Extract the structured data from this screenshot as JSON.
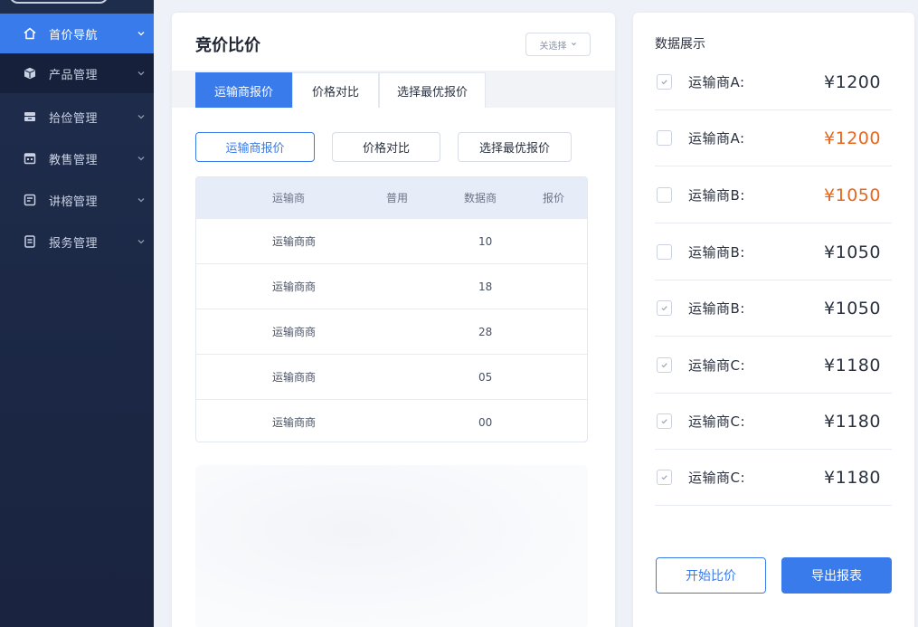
{
  "colors": {
    "accent": "#3a7bec",
    "sidebar_bg": "#1f2d4d",
    "price_highlight": "#e8661e"
  },
  "sidebar": {
    "items": [
      {
        "label": "首价导航",
        "icon": "home-icon",
        "active": true
      },
      {
        "label": "产品管理",
        "icon": "box-icon"
      },
      {
        "label": "拾俭管理",
        "icon": "folder-icon"
      },
      {
        "label": "教售管理",
        "icon": "calendar-icon"
      },
      {
        "label": "讲榕管理",
        "icon": "message-icon"
      },
      {
        "label": "报务管理",
        "icon": "document-icon"
      }
    ]
  },
  "main": {
    "title": "竞价比价",
    "filter": {
      "label": "关选择",
      "icon": "chevron-down-icon"
    },
    "tabs": [
      {
        "label": "运输商报价",
        "active": true
      },
      {
        "label": "价格对比"
      },
      {
        "label": "选择最优报价"
      }
    ],
    "buttons": [
      {
        "label": "运输商报价",
        "active": true
      },
      {
        "label": "价格对比"
      },
      {
        "label": "选择最优报价"
      }
    ],
    "table": {
      "headers": [
        "运输商",
        "普用",
        "数据商",
        "报价"
      ],
      "rows": [
        {
          "name": "运输商商",
          "value": "10"
        },
        {
          "name": "运输商商",
          "value": "18"
        },
        {
          "name": "运输商商",
          "value": "28"
        },
        {
          "name": "运输商商",
          "value": "05"
        },
        {
          "name": "运输商商",
          "value": "00"
        }
      ]
    }
  },
  "panel": {
    "title": "数据展示",
    "rows": [
      {
        "label": "运输商A:",
        "price": "¥1200",
        "checked": true,
        "highlight": false
      },
      {
        "label": "运输商A:",
        "price": "¥1200",
        "checked": false,
        "highlight": true
      },
      {
        "label": "运输商B:",
        "price": "¥1050",
        "checked": false,
        "highlight": true
      },
      {
        "label": "运输商B:",
        "price": "¥1050",
        "checked": false,
        "highlight": false
      },
      {
        "label": "运输商B:",
        "price": "¥1050",
        "checked": true,
        "highlight": false
      },
      {
        "label": "运输商C:",
        "price": "¥1180",
        "checked": true,
        "highlight": false
      },
      {
        "label": "运输商C:",
        "price": "¥1180",
        "checked": true,
        "highlight": false
      },
      {
        "label": "运输商C:",
        "price": "¥1180",
        "checked": true,
        "highlight": false
      }
    ],
    "start_label": "开始比价",
    "export_label": "导出报表"
  }
}
